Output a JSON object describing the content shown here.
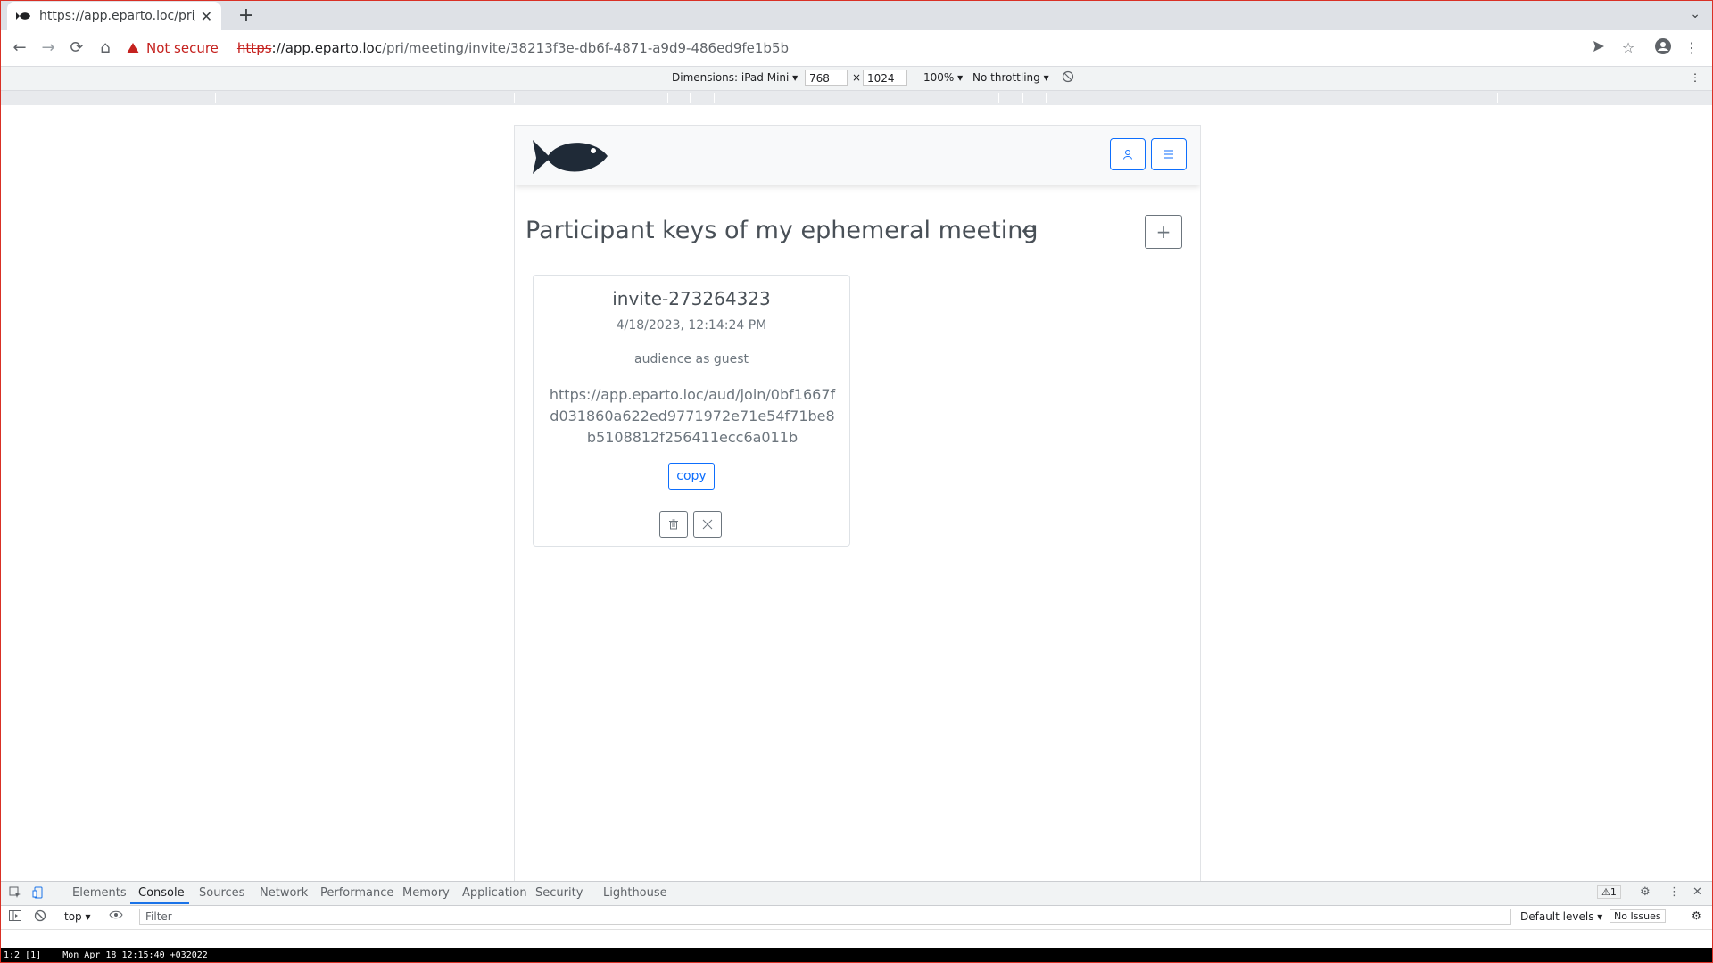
{
  "tab": {
    "title": "https://app.eparto.loc/pri/m",
    "close": "✕"
  },
  "new_tab": "+",
  "tab_menu": "⌄",
  "toolbar": {
    "back": "←",
    "forward": "→",
    "reload": "⟳",
    "home": "⌂",
    "not_secure": "Not secure",
    "url_scheme": "https",
    "url_host": "://app.eparto.loc",
    "url_path": "/pri/meeting/invite/38213f3e-db6f-4871-a9d9-486ed9fe1b5b"
  },
  "device_toolbar": {
    "dimensions_label": "Dimensions: iPad Mini ▾",
    "width": "768",
    "times": "×",
    "height": "1024",
    "zoom": "100% ▾",
    "throttling": "No throttling ▾"
  },
  "page": {
    "title": "Participant keys of my ephemeral meeting",
    "back_icon": "↵",
    "add_icon": "+"
  },
  "invite": {
    "name": "invite-273264323",
    "date": "4/18/2023, 12:14:24 PM",
    "audience": "audience as guest",
    "link": "https://app.eparto.loc/aud/join/0bf1667fd031860a622ed9771972e71e54f71be8b5108812f256411ecc6a011b",
    "copy_label": "copy"
  },
  "devtools": {
    "tabs": [
      "Elements",
      "Console",
      "Sources",
      "Network",
      "Performance",
      "Memory",
      "Application",
      "Security",
      "Lighthouse"
    ],
    "active_tab": "Console",
    "context": "top ▾",
    "filter_placeholder": "Filter",
    "levels": "Default levels ▾",
    "issues": "No Issues",
    "warning_count": "⚠1"
  },
  "statusbar": {
    "text": "1:2 [1]    Mon Apr 18 12:15:40 +032022"
  },
  "colors": {
    "accent": "#0d6efd",
    "danger": "#c5221f",
    "text_muted": "#6c757d"
  }
}
